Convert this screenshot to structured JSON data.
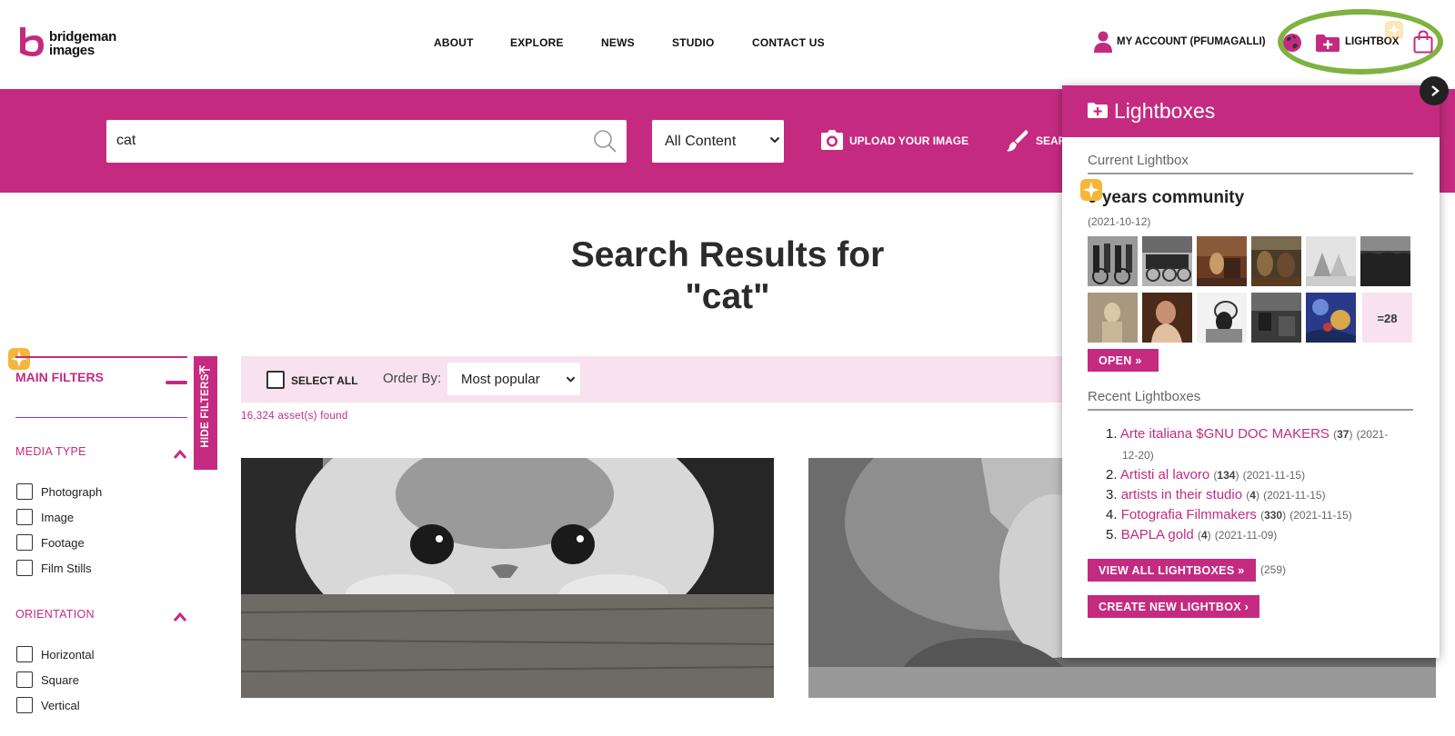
{
  "header": {
    "logo_line1": "bridgeman",
    "logo_line2": "images",
    "nav": [
      "ABOUT",
      "EXPLORE",
      "NEWS",
      "STUDIO",
      "CONTACT US"
    ],
    "account_label": "MY ACCOUNT (PFUMAGALLI)",
    "lightbox_label": "LIGHTBOX",
    "icons": {
      "account": "person-icon",
      "language": "globe-icon",
      "lightbox": "folder-plus-icon",
      "cart": "shopping-bag-icon"
    },
    "highlight_color": "#7fb241"
  },
  "search": {
    "value": "cat",
    "content_filter": "All Content",
    "upload_label": "UPLOAD YOUR IMAGE",
    "search_by_label": "SEAR"
  },
  "results": {
    "title_line1": "Search Results for",
    "title_line2": "\"cat\"",
    "count_text": "16,324 asset(s) found",
    "select_all_label": "SELECT ALL",
    "order_by_label": "Order By:",
    "order_by_value": "Most popular"
  },
  "filters": {
    "main_label": "MAIN FILTERS",
    "hide_label": "HIDE FILTERS",
    "media_type": {
      "title": "MEDIA TYPE",
      "options": [
        "Photograph",
        "Image",
        "Footage",
        "Film Stills"
      ]
    },
    "orientation": {
      "title": "ORIENTATION",
      "options": [
        "Horizontal",
        "Square",
        "Vertical"
      ]
    }
  },
  "lightbox_panel": {
    "title": "Lightboxes",
    "current_label": "Current Lightbox",
    "current_name": "0 years community",
    "current_date": "(2021-10-12)",
    "more_count": "=28",
    "open_label": "OPEN »",
    "recent_label": "Recent Lightboxes",
    "recent": [
      {
        "num": "1.",
        "name": "Arte italiana $GNU DOC MAKERS",
        "count": "37",
        "date_a": "(2021-",
        "date_b": "12-20)"
      },
      {
        "num": "2.",
        "name": "Artisti al lavoro",
        "count": "134",
        "date": "(2021-11-15)"
      },
      {
        "num": "3.",
        "name": "artists in their studio",
        "count": "4",
        "date": "(2021-11-15)"
      },
      {
        "num": "4.",
        "name": "Fotografia Filmmakers",
        "count": "330",
        "date": "(2021-11-15)"
      },
      {
        "num": "5.",
        "name": "BAPLA gold",
        "count": "4",
        "date": "(2021-11-09)"
      }
    ],
    "view_all_label": "VIEW ALL LIGHTBOXES »",
    "view_all_total": "(259)",
    "create_label": "CREATE NEW LIGHTBOX ›"
  },
  "colors": {
    "brand": "#c42b80",
    "toolbar_bg": "#f8e2ef",
    "sparkle": "#f5b73a"
  }
}
